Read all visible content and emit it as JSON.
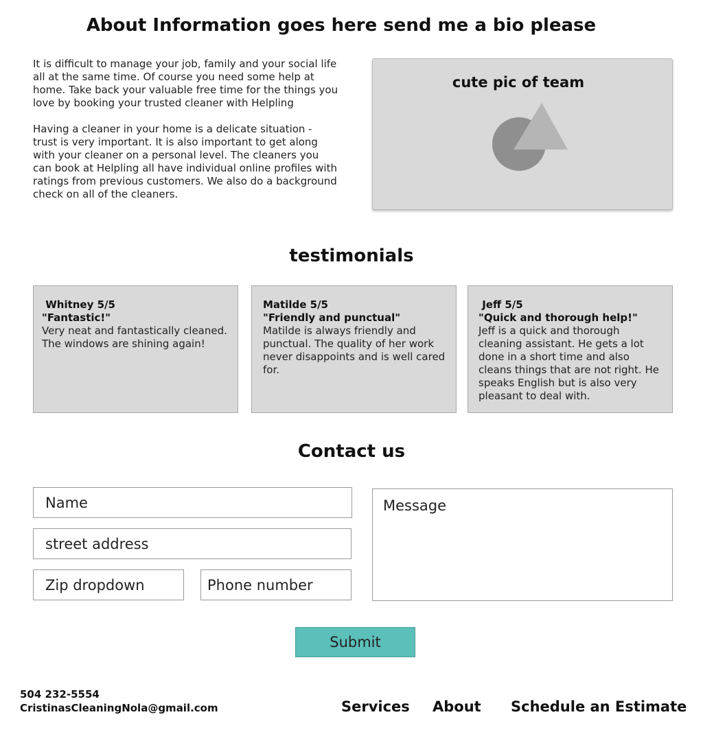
{
  "about": {
    "title": "About Information goes here send me a bio please",
    "paragraphs": [
      "It is difficult to manage your job, family and your social life all at the same time. Of course you need some help at home. Take back your valuable free time for the things you love by booking your trusted cleaner with Helpling",
      "Having a cleaner in your home is a delicate situation - trust is very important. It is also important to get along with your cleaner on a personal level. The cleaners you can book at Helpling all have individual online profiles with ratings from previous customers. We also do a background check on all of the cleaners."
    ],
    "team_pic_label": "cute pic of team"
  },
  "testimonials": {
    "title": "testimonials",
    "items": [
      {
        "name": " Whitney 5/5",
        "quote": "\"Fantastic!\"",
        "body": "Very neat and fantastically cleaned. The windows are shining again!"
      },
      {
        "name": "Matilde 5/5",
        "quote": "\"Friendly and punctual\"",
        "body": "Matilde is always friendly and punctual. The quality of her work never disappoints and is well cared for."
      },
      {
        "name": " Jeff 5/5",
        "quote": "\"Quick and thorough help!\"",
        "body": "Jeff is a quick and thorough cleaning assistant. He gets a lot done in a short time and also cleans things that are not right. He speaks English but is also very pleasant to deal with."
      }
    ]
  },
  "contact": {
    "title": "Contact us",
    "name_placeholder": "Name",
    "address_placeholder": "street address",
    "zip_placeholder": "Zip dropdown",
    "phone_placeholder": "Phone number",
    "message_placeholder": "Message",
    "submit_label": "Submit",
    "submit_color": "#5bbfba"
  },
  "footer": {
    "phone": "504 232-5554",
    "email": "CristinasCleaningNola@gmail.com",
    "nav": [
      "Services",
      "About",
      "Schedule an Estimate"
    ]
  }
}
